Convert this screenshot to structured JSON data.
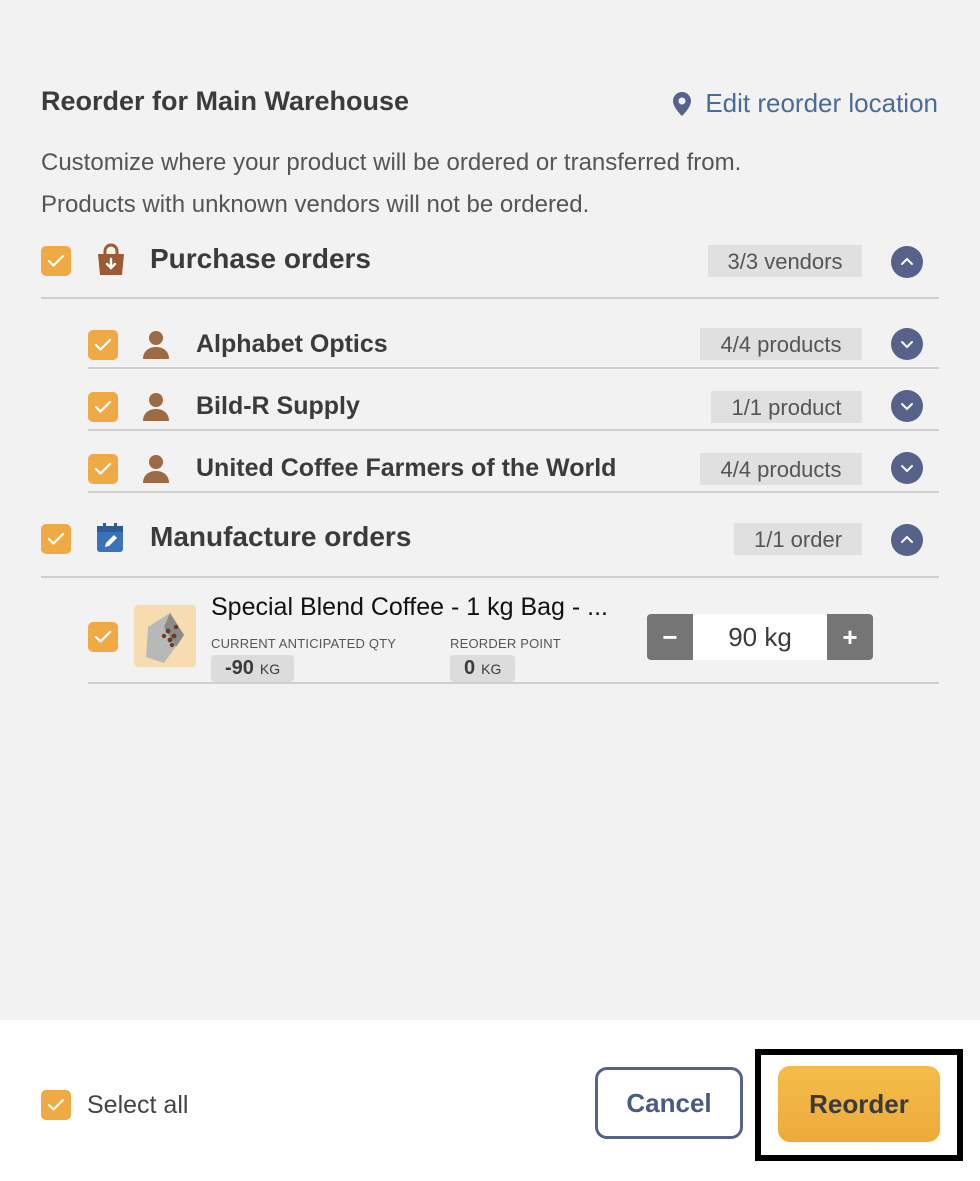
{
  "header": {
    "title": "Reorder for Main Warehouse",
    "edit_location_label": "Edit reorder location",
    "description_line1": "Customize where your product will be ordered or transferred from.",
    "description_line2": "Products with unknown vendors will not be ordered."
  },
  "purchase_orders": {
    "label": "Purchase orders",
    "badge": "3/3 vendors",
    "checked": true,
    "expanded": true,
    "vendors": [
      {
        "name": "Alphabet Optics",
        "badge": "4/4 products",
        "checked": true
      },
      {
        "name": "Bild-R Supply",
        "badge": "1/1 product",
        "checked": true
      },
      {
        "name": "United Coffee Farmers of the World",
        "badge": "4/4 products",
        "checked": true
      }
    ]
  },
  "manufacture_orders": {
    "label": "Manufacture orders",
    "badge": "1/1 order",
    "checked": true,
    "expanded": true,
    "items": [
      {
        "name": "Special Blend Coffee - 1 kg Bag - ...",
        "current_qty_label": "CURRENT ANTICIPATED QTY",
        "current_qty_value": "-90",
        "current_qty_unit": "KG",
        "reorder_point_label": "REORDER POINT",
        "reorder_point_value": "0",
        "reorder_point_unit": "KG",
        "quantity": "90 kg",
        "minus": "−",
        "plus": "+",
        "checked": true
      }
    ]
  },
  "footer": {
    "select_all_label": "Select all",
    "cancel_label": "Cancel",
    "reorder_label": "Reorder"
  },
  "colors": {
    "accent_orange": "#f0aa45",
    "navy": "#566289",
    "link_blue": "#4a6a9a",
    "background": "#f2f2f2"
  }
}
